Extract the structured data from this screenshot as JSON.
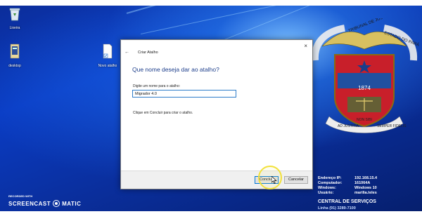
{
  "desktop": {
    "icons": [
      {
        "label": "Lixeira",
        "icon": "recycle-bin-icon"
      },
      {
        "label": "desktop",
        "icon": "shortcut-file-icon"
      },
      {
        "label": "Novo atalho",
        "icon": "new-shortcut-file-icon"
      }
    ]
  },
  "dialog": {
    "title": "Criar Atalho",
    "back_glyph": "←",
    "close_glyph": "×",
    "heading": "Que nome deseja dar ao atalho?",
    "field_label": "Digite um nome para o atalho:",
    "field_value": "Migrador 4.0",
    "hint": "Clique em Concluir para criar o atalho.",
    "finish_label": "Concluir",
    "cancel_label": "Cancelar"
  },
  "emblem": {
    "ribbon_left": "TRIBUNAL DE JUSTIÇA",
    "ribbon_right": "ESTADO DO PARÁ",
    "year": "1874",
    "motto_left": "AD JUSTITIA",
    "motto_top": "NON SIBI",
    "motto_right": "SEMPER FIDELIS"
  },
  "system_info": {
    "rows": [
      {
        "key": "Endereço IP:",
        "value": "192.168.15.4"
      },
      {
        "key": "Computador:",
        "value": "161064A"
      },
      {
        "key": "Windows:",
        "value": "Windows 10"
      },
      {
        "key": "Usuário:",
        "value": "marilia.teles"
      }
    ],
    "central": "CENTRAL DE SERVIÇOS",
    "phone": "Linha (91) 3289-7100"
  },
  "watermark": {
    "recorded": "RECORDED WITH",
    "brand_left": "SCREENCAST",
    "brand_right": "MATIC"
  },
  "colors": {
    "accent": "#0078d7",
    "heading": "#1e3f8c",
    "highlight_ring": "#f2e13a",
    "desktop_blue": "#0a3cc4"
  }
}
